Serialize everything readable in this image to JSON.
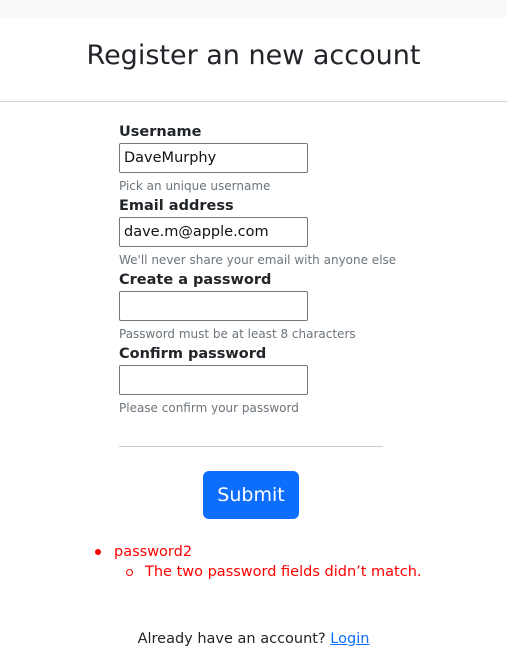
{
  "page": {
    "title": "Register an new account"
  },
  "form": {
    "username": {
      "label": "Username",
      "value": "DaveMurphy",
      "help": "Pick an unique username"
    },
    "email": {
      "label": "Email address",
      "value": "dave.m@apple.com",
      "help": "We'll never share your email with anyone else"
    },
    "password1": {
      "label": "Create a password",
      "value": "",
      "help": "Password must be at least 8 characters"
    },
    "password2": {
      "label": "Confirm password",
      "value": "",
      "help": "Please confirm your password"
    },
    "submit_label": "Submit"
  },
  "errors": {
    "field": "password2",
    "message": "The two password fields didn’t match."
  },
  "footer": {
    "text": "Already have an account? ",
    "link_label": "Login"
  },
  "colors": {
    "primary": "#0d6efd",
    "error": "#ff0000",
    "muted": "#6c757d"
  }
}
